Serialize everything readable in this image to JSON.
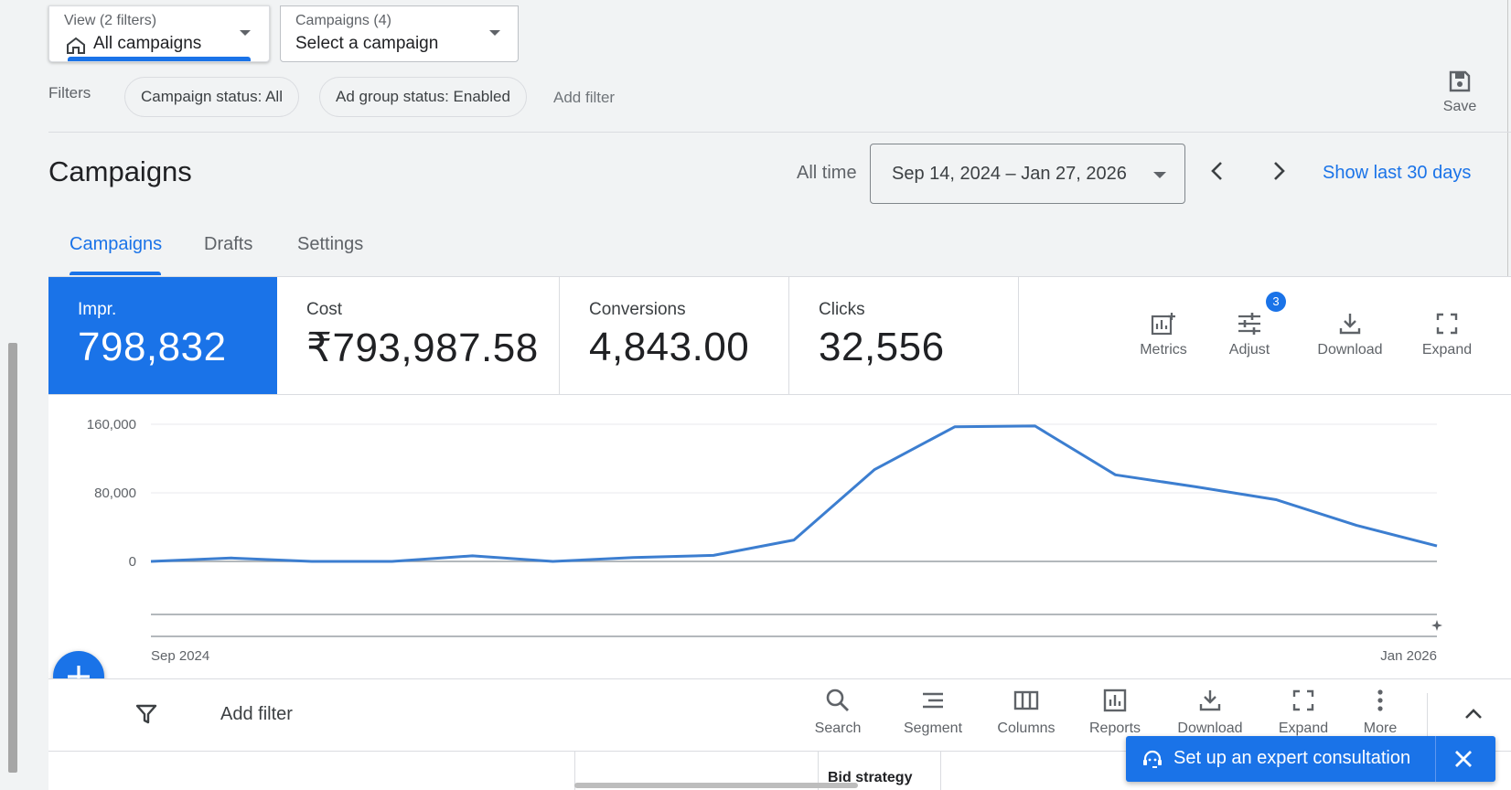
{
  "view_selector": {
    "small_label": "View (2 filters)",
    "value": "All campaigns"
  },
  "campaign_selector": {
    "small_label": "Campaigns (4)",
    "value": "Select a campaign"
  },
  "filters": {
    "label": "Filters",
    "chips": [
      "Campaign status: All",
      "Ad group status: Enabled"
    ],
    "add_filter": "Add filter",
    "save_label": "Save"
  },
  "header": {
    "title": "Campaigns",
    "range_label": "All time",
    "date_range": "Sep 14, 2024 – Jan 27, 2026",
    "show_last": "Show last 30 days"
  },
  "tabs": [
    {
      "label": "Campaigns",
      "active": true
    },
    {
      "label": "Drafts",
      "active": false
    },
    {
      "label": "Settings",
      "active": false
    }
  ],
  "scorecards": [
    {
      "label": "Impr.",
      "value": "798,832",
      "selected": true
    },
    {
      "label": "Cost",
      "value": "₹793,987.58",
      "selected": false
    },
    {
      "label": "Conversions",
      "value": "4,843.00",
      "selected": false
    },
    {
      "label": "Clicks",
      "value": "32,556",
      "selected": false
    }
  ],
  "chart_tools": {
    "metrics": "Metrics",
    "adjust": "Adjust",
    "adjust_badge": "3",
    "download": "Download",
    "expand": "Expand"
  },
  "chart_data": {
    "type": "line",
    "series": [
      {
        "values": [
          0,
          4000,
          0,
          0,
          6500,
          0,
          4500,
          7000,
          25000,
          107000,
          157000,
          158000,
          101000,
          87000,
          72000,
          42000,
          18000
        ]
      }
    ],
    "x_start_label": "Sep 2024",
    "x_end_label": "Jan 2026",
    "y_ticks": [
      "160,000",
      "80,000",
      "0"
    ],
    "ylim": [
      0,
      160000
    ],
    "color": "#3c7ed0",
    "grid": true
  },
  "table_toolbar": {
    "add_filter": "Add filter",
    "buttons": [
      "Search",
      "Segment",
      "Columns",
      "Reports",
      "Download",
      "Expand",
      "More"
    ]
  },
  "table": {
    "visible_header": "Bid strategy"
  },
  "consult_banner": {
    "text": "Set up an expert consultation"
  },
  "colors": {
    "accent": "#1a73e8",
    "background": "#f1f3f4"
  }
}
